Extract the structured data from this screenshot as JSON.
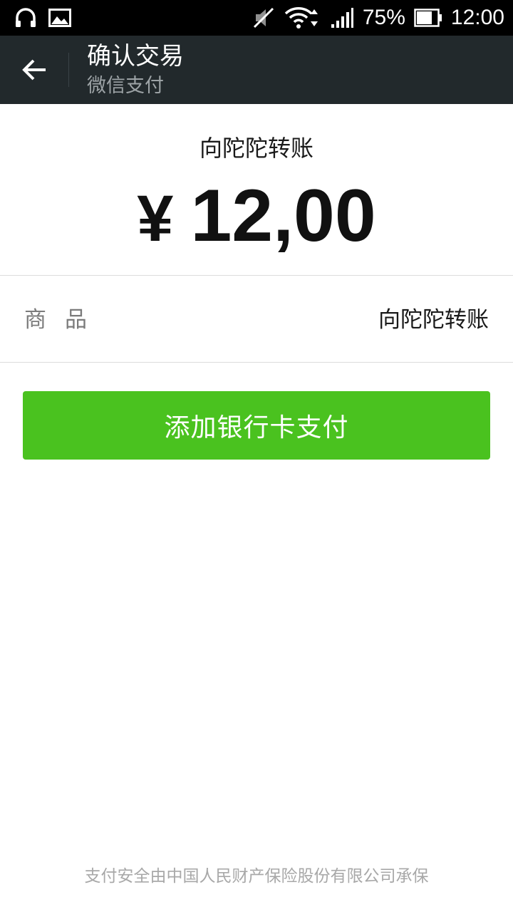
{
  "status_bar": {
    "battery_percent": "75%",
    "battery_level": 0.75,
    "time": "12:00",
    "icons": [
      "headset-icon",
      "image-icon",
      "mute-icon",
      "wifi-icon",
      "signal-icon",
      "battery-icon"
    ]
  },
  "action_bar": {
    "title": "确认交易",
    "subtitle": "微信支付",
    "back_icon": "arrow-left-icon"
  },
  "transaction": {
    "payee": "向陀陀转账",
    "currency_symbol": "¥",
    "amount": "12,00"
  },
  "details": {
    "item_label": "商品",
    "item_value": "向陀陀转账"
  },
  "pay_button": {
    "label": "添加银行卡支付"
  },
  "footer": {
    "note": "支付安全由中国人民财产保险股份有限公司承保"
  },
  "colors": {
    "status_bar_bg": "#000000",
    "action_bar_bg": "#22292c",
    "pay_button_bg": "#4ac21f",
    "footer_text": "#a8a8a8"
  }
}
